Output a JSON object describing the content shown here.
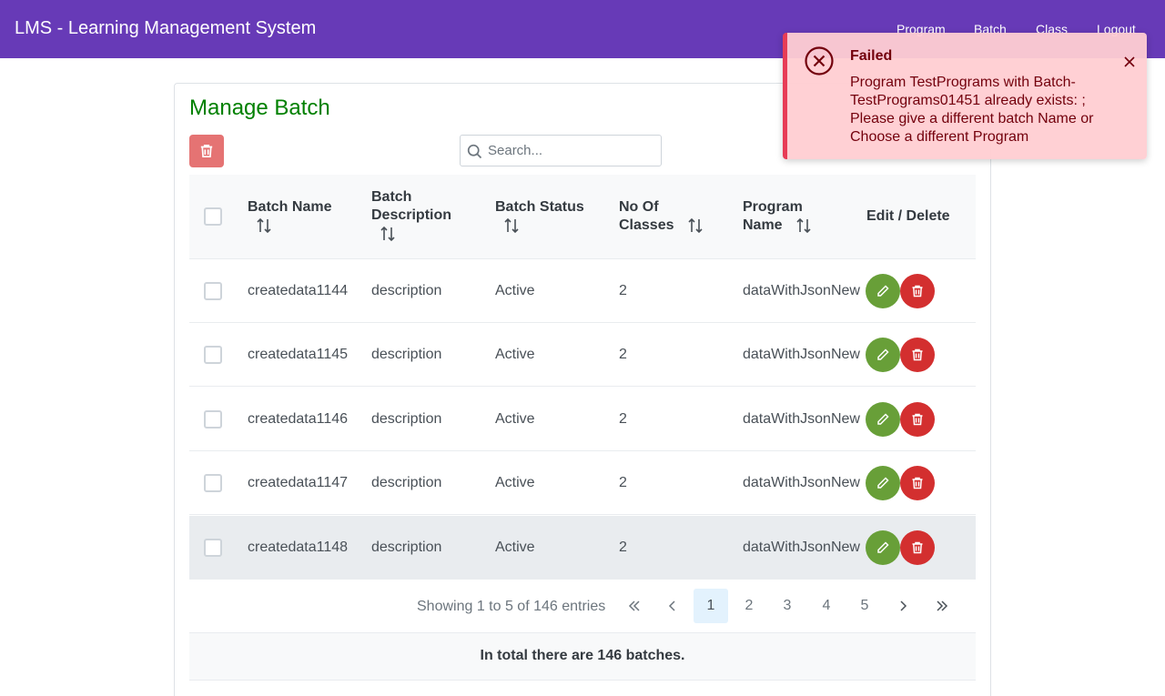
{
  "app": {
    "title": "LMS - Learning Management System"
  },
  "nav": {
    "program": "Program",
    "batch": "Batch",
    "class": "Class",
    "logout": "Logout"
  },
  "page": {
    "title": "Manage Batch"
  },
  "search": {
    "placeholder": "Search..."
  },
  "table": {
    "headers": {
      "batch_name": "Batch Name",
      "batch_description_1": "Batch",
      "batch_description_2": "Description",
      "batch_status": "Batch Status",
      "no_of_classes_1": "No Of",
      "no_of_classes_2": "Classes",
      "program_name_1": "Program",
      "program_name_2": "Name",
      "edit_delete": "Edit / Delete"
    },
    "rows": [
      {
        "name": "createdata1144",
        "description": "description",
        "status": "Active",
        "classes": "2",
        "program": "dataWithJsonNew"
      },
      {
        "name": "createdata1145",
        "description": "description",
        "status": "Active",
        "classes": "2",
        "program": "dataWithJsonNew"
      },
      {
        "name": "createdata1146",
        "description": "description",
        "status": "Active",
        "classes": "2",
        "program": "dataWithJsonNew"
      },
      {
        "name": "createdata1147",
        "description": "description",
        "status": "Active",
        "classes": "2",
        "program": "dataWithJsonNew"
      },
      {
        "name": "createdata1148",
        "description": "description",
        "status": "Active",
        "classes": "2",
        "program": "dataWithJsonNew"
      }
    ]
  },
  "pagination": {
    "report": "Showing 1 to 5 of 146 entries",
    "pages": [
      "1",
      "2",
      "3",
      "4",
      "5"
    ],
    "current": "1"
  },
  "footer": {
    "text": "In total there are 146 batches."
  },
  "toast": {
    "summary": "Failed",
    "detail": "Program TestPrograms with Batch-TestPrograms01451 already exists: ; Please give a different batch Name or Choose a different Program"
  },
  "colors": {
    "header": "#673ab7",
    "title": "#008000",
    "edit": "#689f38",
    "delete": "#d32f2f",
    "bulk_delete": "#e57373",
    "toast_bg": "#ffcdd2",
    "toast_border": "#e73c56"
  },
  "icons": {
    "bulk_delete": "trash-icon",
    "search": "search-icon",
    "sort": "sort-icon",
    "edit": "pencil-icon",
    "delete": "trash-icon",
    "toast": "times-circle-icon",
    "close": "close-icon",
    "first": "double-chevron-left-icon",
    "prev": "chevron-left-icon",
    "next": "chevron-right-icon",
    "last": "double-chevron-right-icon"
  }
}
